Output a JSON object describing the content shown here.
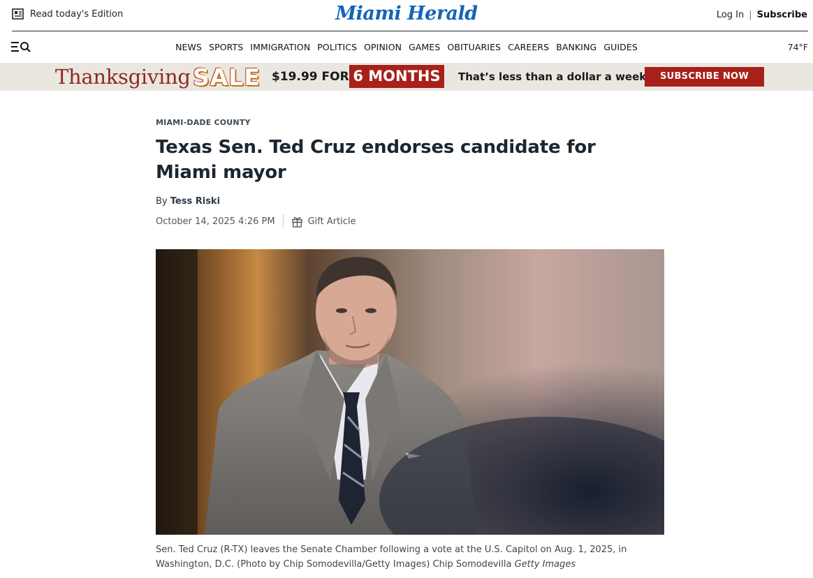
{
  "header": {
    "edition_label": "Read today's Edition",
    "logo": "Miami Herald",
    "login_label": "Log In",
    "separator": "|",
    "subscribe_label": "Subscribe"
  },
  "nav": {
    "items": [
      "NEWS",
      "SPORTS",
      "IMMIGRATION",
      "POLITICS",
      "OPINION",
      "GAMES",
      "OBITUARIES",
      "CAREERS",
      "BANKING",
      "GUIDES"
    ],
    "temperature": "74°F",
    "menu_icon": "menu-search-icon"
  },
  "promo": {
    "thanksgiving": "Thanksgiving",
    "sale": "SALE",
    "price": "$19.99 FOR",
    "months": "6 MONTHS",
    "tagline": "That’s less than a dollar a week!",
    "cta": "SUBSCRIBE NOW",
    "colors": {
      "brand_red": "#a8201a",
      "banner_bg": "#e9e7e0"
    }
  },
  "article": {
    "kicker": "MIAMI-DADE COUNTY",
    "headline": "Texas Sen. Ted Cruz endorses candidate for Miami mayor",
    "by": "By",
    "author": "Tess Riski",
    "date": "October 14, 2025 4:26 PM",
    "gift_label": "Gift Article",
    "caption": "Sen. Ted Cruz (R-TX) leaves the Senate Chamber following a vote at the U.S. Capitol on Aug. 1, 2025, in Washington, D.C. (Photo by Chip Somodevilla/Getty Images) Chip Somodevilla",
    "caption_credit": "Getty Images"
  },
  "colors": {
    "logo_blue": "#1463b8",
    "headline": "#1b2630"
  }
}
